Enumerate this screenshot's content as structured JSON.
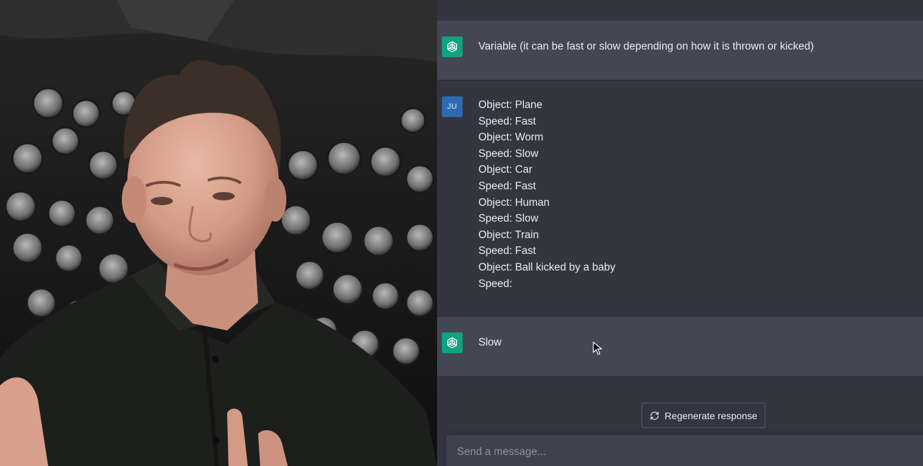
{
  "chat": {
    "messages": [
      {
        "role": "assistant",
        "avatar_icon": "openai-logo-icon",
        "lines": [
          "Variable (it can be fast or slow depending on how it is thrown or kicked)"
        ]
      },
      {
        "role": "user",
        "avatar_initials": "JU",
        "lines": [
          "Object: Plane",
          "Speed: Fast",
          "Object: Worm",
          "Speed: Slow",
          "Object: Car",
          "Speed: Fast",
          "Object: Human",
          "Speed: Slow",
          "Object: Train",
          "Speed: Fast",
          "Object: Ball kicked by a baby",
          "Speed:"
        ]
      },
      {
        "role": "assistant",
        "avatar_icon": "openai-logo-icon",
        "lines": [
          "Slow"
        ]
      }
    ],
    "regenerate": {
      "label": "Regenerate response",
      "icon": "refresh-icon"
    },
    "composer": {
      "placeholder": "Send a message...",
      "value": ""
    }
  },
  "colors": {
    "assistant_row_bg": "#444654",
    "user_row_bg": "#343541",
    "gpt_avatar": "#10a37f",
    "user_avatar": "#2b6cb0",
    "composer_bg": "#40414f"
  }
}
